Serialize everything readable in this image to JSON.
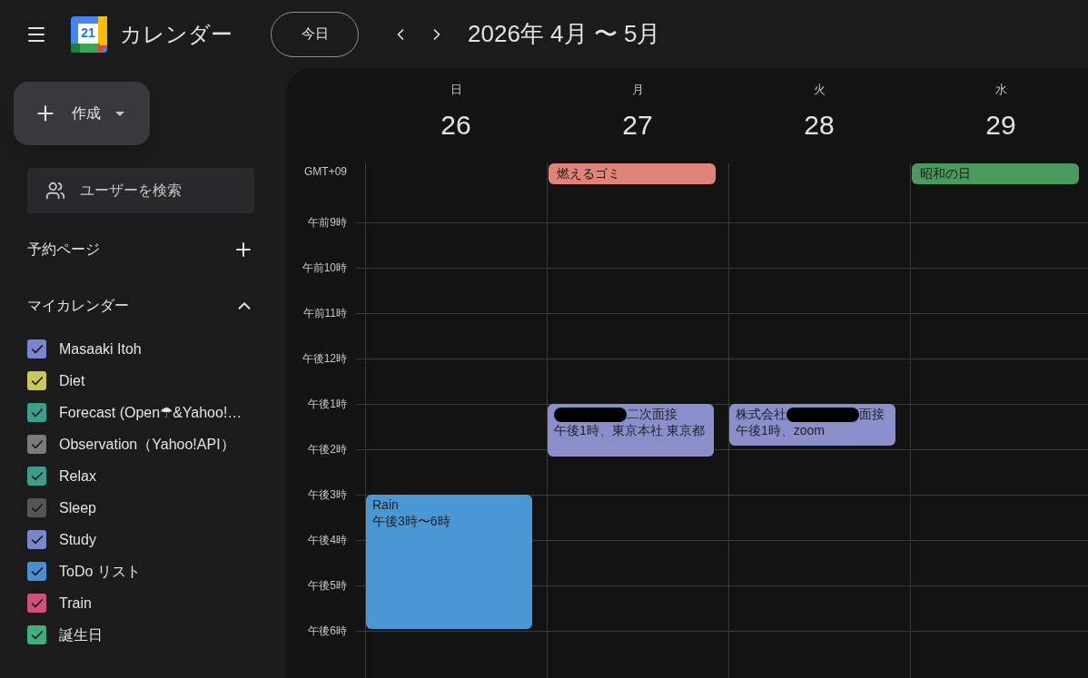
{
  "header": {
    "app_name": "カレンダー",
    "logo_number": "21",
    "today_button": "今日",
    "range_title": "2026年 4月 〜 5月"
  },
  "sidebar": {
    "create_button": "作成",
    "people_search": {
      "placeholder": "ユーザーを検索"
    },
    "booking_pages": "予約ページ",
    "my_calendars": {
      "title": "マイカレンダー",
      "expanded": true,
      "items": [
        {
          "name": "Masaaki Itoh",
          "checked": true,
          "color": "#7986cb"
        },
        {
          "name": "Diet",
          "checked": true,
          "color": "#c9c958"
        },
        {
          "name": "Forecast (Open☂&Yahoo!…",
          "checked": true,
          "color": "#3b9e8c"
        },
        {
          "name": "Observation（Yahoo!API）",
          "checked": true,
          "color": "#7a7a7a"
        },
        {
          "name": "Relax",
          "checked": true,
          "color": "#3b9e8c"
        },
        {
          "name": "Sleep",
          "checked": true,
          "color": "#555555"
        },
        {
          "name": "Study",
          "checked": true,
          "color": "#7986cb"
        },
        {
          "name": "ToDo リスト",
          "checked": true,
          "color": "#4a8fcf"
        },
        {
          "name": "Train",
          "checked": true,
          "color": "#d0507a"
        },
        {
          "name": "誕生日",
          "checked": true,
          "color": "#3fae7a"
        }
      ]
    }
  },
  "calendar": {
    "timezone": "GMT+09",
    "days": [
      {
        "weekday": "日",
        "date": "26",
        "events": [
          {
            "segments": [
              {
                "kind": "text",
                "text": "Rain"
              }
            ],
            "time": "午後3時〜6時",
            "color": "#4a98d3"
          }
        ]
      },
      {
        "weekday": "月",
        "date": "27",
        "all_day": [
          {
            "title": "燃えるゴミ",
            "color": "#e0847a"
          }
        ],
        "events": [
          {
            "segments": [
              {
                "kind": "redaction"
              },
              {
                "kind": "text",
                "text": "二次面接"
              }
            ],
            "time": "午後1時、東京本社 東京都",
            "color": "#8a8fcc"
          }
        ]
      },
      {
        "weekday": "火",
        "date": "28",
        "events": [
          {
            "segments": [
              {
                "kind": "text",
                "text": "株式会社"
              },
              {
                "kind": "redaction"
              },
              {
                "kind": "text",
                "text": "面接"
              }
            ],
            "time": "午後1時、zoom",
            "color": "#8a8fcc"
          }
        ]
      },
      {
        "weekday": "水",
        "date": "29",
        "all_day": [
          {
            "title": "昭和の日",
            "color": "#4a9a5e"
          }
        ]
      }
    ],
    "hours": [
      "午前9時",
      "午前10時",
      "午前11時",
      "午後12時",
      "午後1時",
      "午後2時",
      "午後3時",
      "午後4時",
      "午後5時",
      "午後6時"
    ]
  }
}
